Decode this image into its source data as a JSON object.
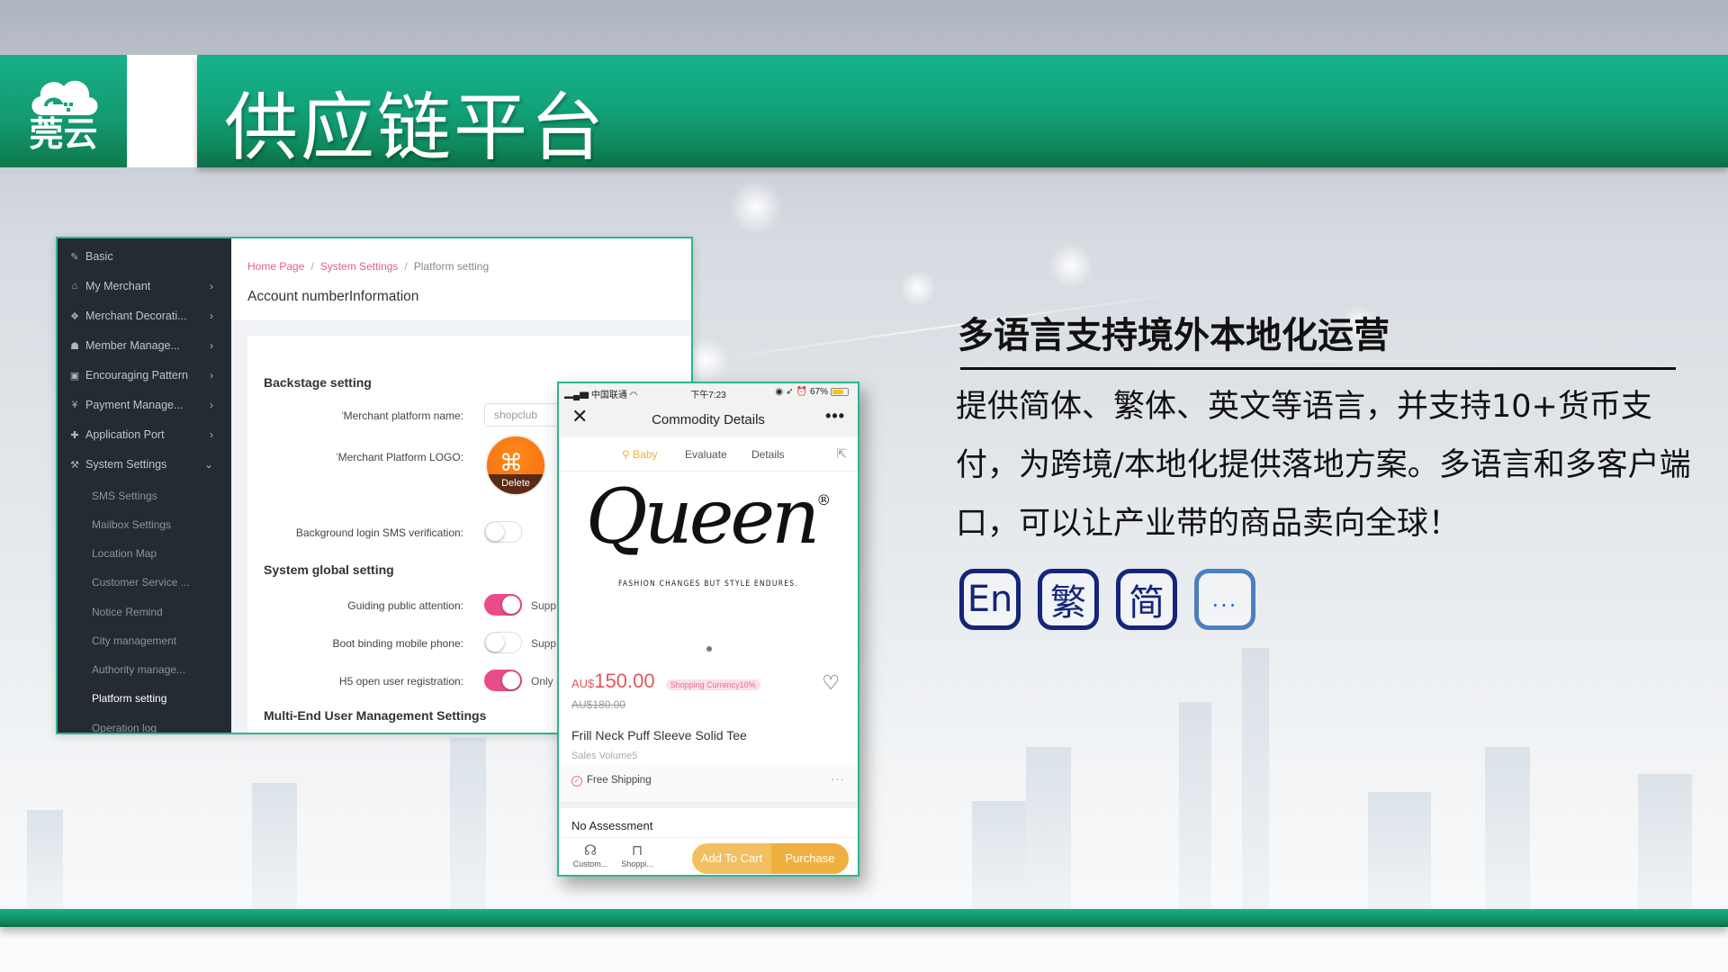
{
  "header": {
    "logo_text": "莞云",
    "title": "供应链平台"
  },
  "admin": {
    "sidebar": {
      "items": [
        {
          "icon": "edit-icon",
          "glyph": "✎",
          "label": "Basic",
          "chevron": false
        },
        {
          "icon": "home-icon",
          "glyph": "⌂",
          "label": "My Merchant",
          "chevron": true
        },
        {
          "icon": "cubes-icon",
          "glyph": "❖",
          "label": "Merchant Decorati...",
          "chevron": true
        },
        {
          "icon": "users-icon",
          "glyph": "☗",
          "label": "Member Manage...",
          "chevron": true
        },
        {
          "icon": "money-icon",
          "glyph": "▣",
          "label": "Encouraging Pattern",
          "chevron": true
        },
        {
          "icon": "yen-icon",
          "glyph": "¥",
          "label": "Payment Manage...",
          "chevron": true
        },
        {
          "icon": "puzzle-icon",
          "glyph": "✚",
          "label": "Application Port",
          "chevron": true
        },
        {
          "icon": "gavel-icon",
          "glyph": "⚒",
          "label": "System Settings",
          "chevron": "down"
        }
      ],
      "subitems": [
        {
          "label": "SMS Settings",
          "active": false
        },
        {
          "label": "Mailbox Settings",
          "active": false
        },
        {
          "label": "Location Map",
          "active": false
        },
        {
          "label": "Customer Service ...",
          "active": false
        },
        {
          "label": "Notice Remind",
          "active": false
        },
        {
          "label": "City management",
          "active": false
        },
        {
          "label": "Authority manage...",
          "active": false
        },
        {
          "label": "Platform setting",
          "active": true
        },
        {
          "label": "Operation log",
          "active": false
        }
      ]
    },
    "breadcrumb": [
      "Home Page",
      "System Settings",
      "Platform setting"
    ],
    "breadcrumb_sep": "/",
    "page_heading": "Account numberInformation",
    "backstage": {
      "heading": "Backstage setting",
      "platform_name_label": "Merchant platform name:",
      "platform_name_value": "shopclub",
      "logo_label": "Merchant Platform LOGO:",
      "logo_delete": "Delete",
      "sms_label": "Background login SMS verification:",
      "sms_enabled": false
    },
    "global": {
      "heading": "System global setting",
      "toggles": [
        {
          "label": "Guiding public attention:",
          "on": true,
          "note": "Supp"
        },
        {
          "label": "Boot binding mobile phone:",
          "on": false,
          "note": "Supp"
        },
        {
          "label": "H5 open user registration:",
          "on": true,
          "note": "Only"
        }
      ]
    },
    "multi_end_heading": "Multi-End User Management Settings"
  },
  "phone": {
    "status": {
      "carrier": "中国联通",
      "time": "下午7:23",
      "battery": "67%"
    },
    "nav_title": "Commodity Details",
    "tabs": [
      "Baby",
      "Evaluate",
      "Details"
    ],
    "brand": "Queen",
    "slogan": "FASHION CHANGES  BUT STYLE ENDURES.",
    "price_currency": "AU$",
    "price": "150.00",
    "badge": "Shopping Currency10%",
    "old_price": "AU$180.00",
    "product_name": "Frill Neck Puff Sleeve Solid Tee",
    "sales": "Sales Volume5",
    "shipping": "Free Shipping",
    "no_assessment": "No Assessment",
    "bottom": {
      "customer": "Custom...",
      "shopping": "Shoppi...",
      "add_to_cart": "Add To Cart",
      "purchase": "Purchase"
    },
    "colors": {
      "accent": "#f0b040",
      "price": "#e05a5a",
      "frame": "#2db68f"
    }
  },
  "feature": {
    "title": "多语言支持境外本地化运营",
    "body": "提供简体、繁体、英文等语言，并支持10+货币支付，为跨境/本地化提供落地方案。多语言和多客户端口，可以让产业带的商品卖向全球！",
    "languages": [
      "En",
      "繁",
      "简",
      "..."
    ]
  },
  "theme": {
    "brand_green": "#13a37b",
    "lang_icon_color": "#14257a"
  }
}
